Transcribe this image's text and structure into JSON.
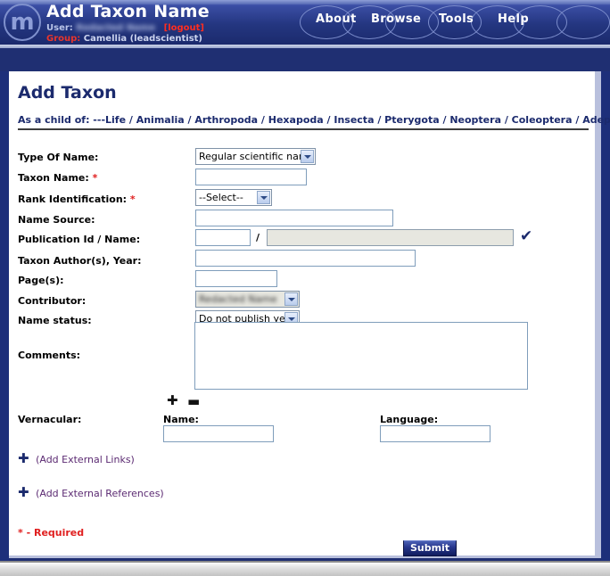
{
  "header": {
    "logo_letter": "m",
    "app_title": "Add Taxon Name",
    "user_label": "User:",
    "user_value": "Redacted Name",
    "logout_label": "[logout]",
    "group_label": "Group:",
    "group_value": "Camellia (leadscientist)",
    "nav": [
      {
        "label": "About"
      },
      {
        "label": "Browse"
      },
      {
        "label": "Tools"
      },
      {
        "label": "Help"
      }
    ]
  },
  "content": {
    "page_title": "Add Taxon",
    "breadcrumb": "As a child of: ---Life / Animalia / Arthropoda / Hexapoda / Insecta / Pterygota / Neoptera / Coleoptera / Adephaga [ Suborder ]"
  },
  "form": {
    "type_of_name": {
      "label": "Type Of Name:",
      "value": "Regular scientific name"
    },
    "taxon_name": {
      "label": "Taxon Name:",
      "required": "*",
      "value": ""
    },
    "rank_identification": {
      "label": "Rank Identification:",
      "required": "*",
      "value": "--Select--"
    },
    "name_source": {
      "label": "Name Source:",
      "value": ""
    },
    "publication": {
      "label": "Publication Id / Name:",
      "id_value": "",
      "separator": "/",
      "name_value": "",
      "check_icon": "✔"
    },
    "taxon_authors_year": {
      "label": "Taxon Author(s), Year:",
      "value": ""
    },
    "pages": {
      "label": "Page(s):",
      "value": ""
    },
    "contributor": {
      "label": "Contributor:",
      "value": "Redacted Name"
    },
    "name_status": {
      "label": "Name status:",
      "value": "Do not publish yet"
    },
    "comments": {
      "label": "Comments:",
      "value": ""
    },
    "row_controls": {
      "add": "✚",
      "remove": "▬"
    },
    "vernacular": {
      "label": "Vernacular:",
      "name_label": "Name:",
      "name_value": "",
      "language_label": "Language:",
      "language_value": ""
    },
    "add_external_links": {
      "icon": "✚",
      "label": "(Add External Links)"
    },
    "add_external_references": {
      "icon": "✚",
      "label": "(Add External References)"
    },
    "required_note": "* - Required",
    "submit_label": "Submit"
  }
}
